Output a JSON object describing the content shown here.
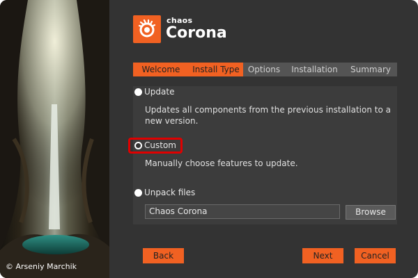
{
  "side": {
    "credit": "© Arseniy Marchik"
  },
  "brand": {
    "small": "chaos",
    "big": "Corona"
  },
  "tabs": [
    {
      "label": "Welcome",
      "active": true
    },
    {
      "label": "Install Type",
      "active": true
    },
    {
      "label": "Options",
      "active": false
    },
    {
      "label": "Installation",
      "active": false
    },
    {
      "label": "Summary",
      "active": false
    }
  ],
  "options": {
    "update": {
      "label": "Update",
      "description": "Updates all components from the previous installation to a new version.",
      "selected": false
    },
    "custom": {
      "label": "Custom",
      "description": "Manually choose features to update.",
      "selected": true
    },
    "unpack": {
      "label": "Unpack files",
      "path": "Chaos Corona",
      "browse_label": "Browse",
      "selected": false
    }
  },
  "footer": {
    "back_label": "Back",
    "next_label": "Next",
    "cancel_label": "Cancel"
  },
  "colors": {
    "accent": "#f16122",
    "background": "#333333",
    "highlight": "#e00000"
  },
  "icons": {
    "logo": "corona-swirl-icon"
  }
}
